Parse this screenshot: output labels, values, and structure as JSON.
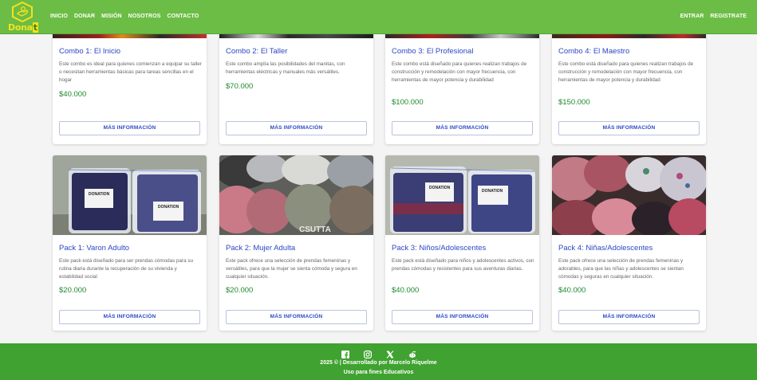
{
  "brand": {
    "name_main": "Dona",
    "name_last": "t"
  },
  "nav": {
    "links": [
      "Inicio",
      "Donar",
      "Misión",
      "Nosotros",
      "Contacto"
    ],
    "right": [
      "Entrar",
      "Registrate"
    ]
  },
  "colors": {
    "navbar": "#6cbd45",
    "footer": "#40a230",
    "title": "#2b49c4",
    "price": "#1f8a2e",
    "logo": "#f5e21a"
  },
  "cards_row1": [
    {
      "title": "Combo 1: El Inicio",
      "desc": "Este combo es ideal para quienes comienzan a equipar su taller o necesitan herramientas básicas para tareas sencillas en el hogar",
      "price": "$40.000",
      "button": "Más información"
    },
    {
      "title": "Combo 2: El Taller",
      "desc": "Este combo amplía las posibilidades del manitas, con herramientas eléctricas y manuales más versátiles.",
      "price": "$70.000",
      "button": "Más información"
    },
    {
      "title": "Combo 3: El Profesional",
      "desc": "Este combo está diseñado para quienes realizan trabajos de construcción y remodelación con mayor frecuencia, con herramientas de mayor potencia y durabilidad",
      "price": "$100.000",
      "button": "Más información"
    },
    {
      "title": "Combo 4: El Maestro",
      "desc": "Este combo está diseñado para quienes realizan trabajos de construcción y remodelación con mayor frecuencia, con herramientas de mayor potencia y durabilidad",
      "price": "$150.000",
      "button": "Más información"
    }
  ],
  "cards_row2": [
    {
      "title": "Pack 1: Varon Adulto",
      "desc": "Este pack está diseñado para ser prendas cómodas para su rutina diaria durante la recuperación de su vivienda y estabilidad social",
      "price": "$20.000",
      "button": "Más información",
      "bag_label": "DONATION"
    },
    {
      "title": "Pack 2: Mujer Adulta",
      "desc": "Este pack ofrece una selección de prendas femeninas y versátiles, para que la mujer se sienta cómoda y segura en cualquier situación.",
      "price": "$20.000",
      "button": "Más información",
      "bag_label": "CSUTTA"
    },
    {
      "title": "Pack 3: Niños/Adolescentes",
      "desc": "Este pack está diseñado para niños y adolescentes activos, con prendas cómodas y resistentes para sus aventuras diarias.",
      "price": "$40.000",
      "button": "Más información",
      "bag_label": "DONATION"
    },
    {
      "title": "Pack 4: Niñas/Adolescentes",
      "desc": "Este pack ofrece una selección de prendas femeninas y adorables, para que las niñas y adolescentes se sientan cómodas y seguras en cualquier situación.",
      "price": "$40.000",
      "button": "Más información"
    }
  ],
  "footer": {
    "social": [
      "facebook-icon",
      "instagram-icon",
      "x-icon",
      "reddit-icon"
    ],
    "line1": "2025 © | Desarrollado por Marcelo Riquelme",
    "line2": "Uso para fines Educativos"
  }
}
